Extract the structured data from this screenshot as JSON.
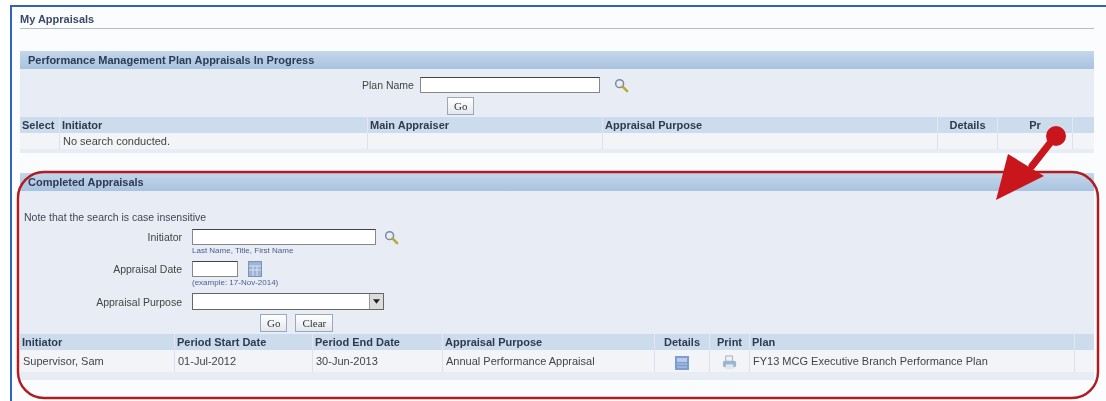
{
  "page": {
    "title": "My Appraisals"
  },
  "in_progress": {
    "title": "Performance Management Plan Appraisals In Progress",
    "plan_label": "Plan Name",
    "go": "Go",
    "columns": [
      {
        "label": "Select"
      },
      {
        "label": "Initiator"
      },
      {
        "label": "Main Appraiser"
      },
      {
        "label": "Appraisal Purpose"
      },
      {
        "label": "Details"
      },
      {
        "label": "Pr"
      }
    ],
    "empty_message": "No search conducted."
  },
  "completed": {
    "title": "Completed Appraisals",
    "note": "Note that the search is case insensitive",
    "fields": [
      {
        "kind": "search",
        "label": "Initiator",
        "hint": "Last Name, Title, First Name"
      },
      {
        "kind": "date",
        "label": "Appraisal Date",
        "hint": "(example: 17-Nov-2014)"
      },
      {
        "kind": "select",
        "label": "Appraisal Purpose"
      }
    ],
    "go": "Go",
    "clear": "Clear",
    "columns": [
      {
        "label": "Initiator",
        "kind": "text"
      },
      {
        "label": "Period Start Date",
        "kind": "text"
      },
      {
        "label": "Period End Date",
        "kind": "text"
      },
      {
        "label": "Appraisal Purpose",
        "kind": "text"
      },
      {
        "label": "Details",
        "kind": "details"
      },
      {
        "label": "Print",
        "kind": "print"
      },
      {
        "label": "Plan",
        "kind": "text"
      }
    ],
    "rows": [
      {
        "cells": [
          "Supervisor, Sam",
          "01-Jul-2012",
          "30-Jun-2013",
          "Annual Performance Appraisal",
          "",
          "",
          "FY13 MCG Executive Branch Performance Plan"
        ]
      }
    ]
  }
}
